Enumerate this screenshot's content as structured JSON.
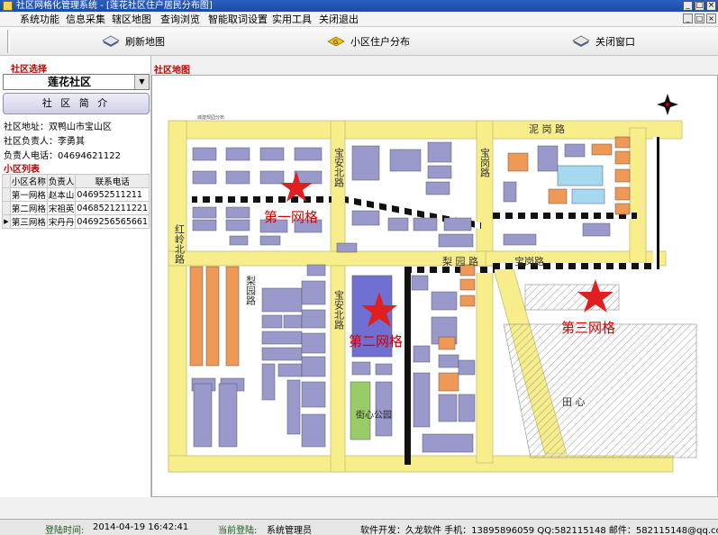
{
  "window": {
    "title": "社区网格化管理系统 - [莲花社区住户居民分布图]",
    "buttons": [
      "_",
      "□",
      "×"
    ]
  },
  "menu": [
    "系统功能",
    "信息采集",
    "辖区地图",
    "查询浏览",
    "智能取词设置",
    "实用工具",
    "关闭退出"
  ],
  "mdi_buttons": [
    "_",
    "□",
    "×"
  ],
  "toolbar": {
    "refresh": "刷新地图",
    "distribution": "小区住户分布",
    "close": "关闭窗口"
  },
  "left": {
    "community_title": "社区选择",
    "community_value": "莲花社区",
    "intro_button": "社 区 简 介",
    "address": "社区地址：双鸭山市宝山区",
    "leader": "社区负责人：李勇其",
    "phone": "负责人电话：04694621122",
    "list_title": "小区列表",
    "table": {
      "headers": [
        "小区名称",
        "负责人",
        "联系电话"
      ],
      "rows": [
        [
          "第一网格",
          "赵本山",
          "046952511211"
        ],
        [
          "第二网格",
          "宋祖英",
          "0468521211221"
        ],
        [
          "第三网格",
          "宋丹丹",
          "0469256565661"
        ]
      ]
    }
  },
  "map": {
    "title": "社区地图",
    "road_labels": {
      "north_road": "泥  岗  路",
      "baoan_north_1": "宝安北路",
      "baoan_north_2": "宝安北路",
      "lichu": "梨  园  路",
      "lichu_v": "梨园路",
      "hongling": "红岭北路",
      "baogang": "宝岗路",
      "baogang2": "宝岗路",
      "tianxin": "田  心",
      "park": "街心公园"
    },
    "grids": [
      "第一网格",
      "第二网格",
      "第三网格"
    ]
  },
  "status": {
    "login_time_label": "登陆时间:",
    "login_time": "2014-04-19 16:42:41",
    "current_login_label": "当前登陆:",
    "current_login": "系统管理员",
    "developer": "软件开发：久龙软件  手机：13895896059  QQ:582115148  邮件：582115148@qq.com"
  },
  "colors": {
    "accent_red": "#c00000",
    "road": "#f7ed8a",
    "block": "#9999cc",
    "orange": "#ee9955"
  }
}
